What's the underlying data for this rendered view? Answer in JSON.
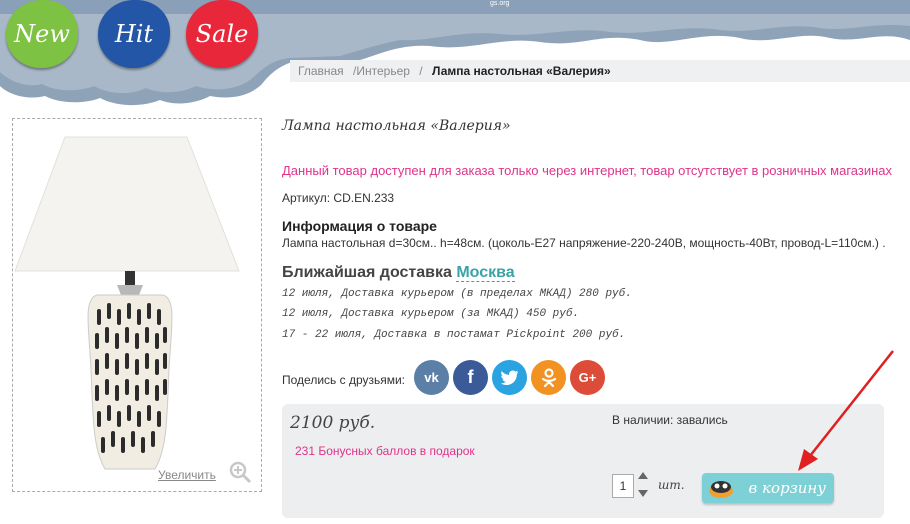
{
  "header": {
    "top_text": "gs.org",
    "badges": [
      "New",
      "Hit",
      "Sale"
    ]
  },
  "breadcrumb": {
    "home": "Главная",
    "category": "/Интерьер",
    "separator": "/",
    "current": "Лампа настольная «Валерия»"
  },
  "product": {
    "title": "Лампа настольная «Валерия»",
    "notice": "Данный товар доступен для заказа только через интернет, товар отсутствует в розничных магазинах",
    "sku": "Артикул: CD.EN.233",
    "info_heading": "Информация о товаре",
    "info_text": "Лампа настольная d=30см.. h=48см. (цоколь-E27 напряжение-220-240В, мощность-40Вт, провод-L=110см.) .",
    "zoom_label": "Увеличить"
  },
  "delivery": {
    "heading": "Ближайшая доставка",
    "city": "Москва",
    "items": [
      "12 июля, Доставка курьером (в пределах МКАД) 280 руб.",
      "12 июля, Доставка курьером (за МКАД) 450 руб.",
      "17 - 22 июля, Доставка в постамат Pickpoint 200 руб."
    ]
  },
  "share": {
    "label": "Поделись с друзьями:",
    "networks": [
      {
        "name": "vk",
        "glyph": "vk",
        "color": "#5b7fa6"
      },
      {
        "name": "facebook",
        "glyph": "f",
        "color": "#3b5b98"
      },
      {
        "name": "twitter",
        "glyph": "t",
        "color": "#2aa3e0"
      },
      {
        "name": "odnoklassniki",
        "glyph": "ok",
        "color": "#f29222"
      },
      {
        "name": "google-plus",
        "glyph": "G+",
        "color": "#dd4b39"
      }
    ]
  },
  "buy": {
    "price": "2100 руб.",
    "bonus": "231 Бонусных баллов в подарок",
    "stock": "В наличии: завались",
    "quantity": "1",
    "unit": "шт.",
    "cart_label": "в корзину"
  },
  "colors": {
    "accent_pink": "#e0338a",
    "accent_teal": "#3aa3a8",
    "arrow_red": "#e02020"
  }
}
